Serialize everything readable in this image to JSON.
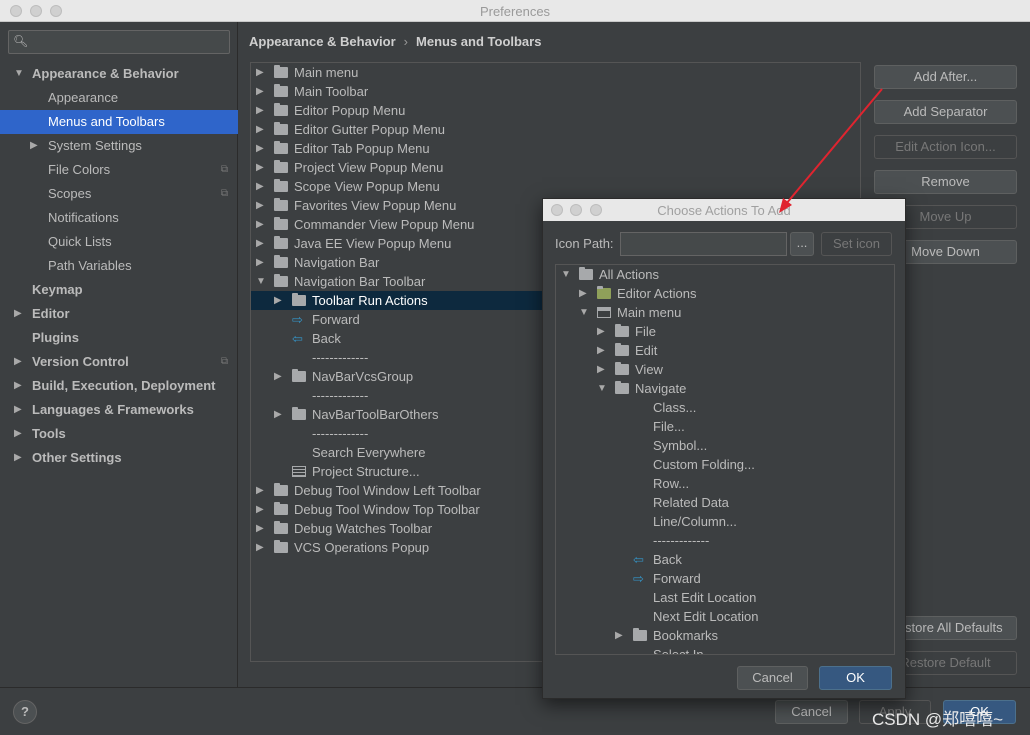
{
  "window": {
    "title": "Preferences"
  },
  "sidebar": {
    "search_placeholder": "",
    "search_icon": "search-icon",
    "items": [
      {
        "label": "Appearance & Behavior",
        "bold": true,
        "expanded": true,
        "level": 0
      },
      {
        "label": "Appearance",
        "level": 1
      },
      {
        "label": "Menus and Toolbars",
        "level": 1,
        "selected": true
      },
      {
        "label": "System Settings",
        "level": 1,
        "collapsed": true
      },
      {
        "label": "File Colors",
        "level": 1,
        "copy": true
      },
      {
        "label": "Scopes",
        "level": 1,
        "copy": true
      },
      {
        "label": "Notifications",
        "level": 1
      },
      {
        "label": "Quick Lists",
        "level": 1
      },
      {
        "label": "Path Variables",
        "level": 1
      },
      {
        "label": "Keymap",
        "bold": true,
        "level": 0
      },
      {
        "label": "Editor",
        "bold": true,
        "level": 0,
        "collapsed": true
      },
      {
        "label": "Plugins",
        "bold": true,
        "level": 0
      },
      {
        "label": "Version Control",
        "bold": true,
        "level": 0,
        "collapsed": true,
        "copy": true
      },
      {
        "label": "Build, Execution, Deployment",
        "bold": true,
        "level": 0,
        "collapsed": true
      },
      {
        "label": "Languages & Frameworks",
        "bold": true,
        "level": 0,
        "collapsed": true
      },
      {
        "label": "Tools",
        "bold": true,
        "level": 0,
        "collapsed": true
      },
      {
        "label": "Other Settings",
        "bold": true,
        "level": 0,
        "collapsed": true
      }
    ]
  },
  "breadcrumb": {
    "part1": "Appearance & Behavior",
    "separator": "›",
    "part2": "Menus and Toolbars"
  },
  "main_tree": {
    "rows": [
      {
        "label": "Main menu",
        "level": 0,
        "arrow": "right",
        "icon": "folder"
      },
      {
        "label": "Main Toolbar",
        "level": 0,
        "arrow": "right",
        "icon": "folder"
      },
      {
        "label": "Editor Popup Menu",
        "level": 0,
        "arrow": "right",
        "icon": "folder"
      },
      {
        "label": "Editor Gutter Popup Menu",
        "level": 0,
        "arrow": "right",
        "icon": "folder"
      },
      {
        "label": "Editor Tab Popup Menu",
        "level": 0,
        "arrow": "right",
        "icon": "folder"
      },
      {
        "label": "Project View Popup Menu",
        "level": 0,
        "arrow": "right",
        "icon": "folder"
      },
      {
        "label": "Scope View Popup Menu",
        "level": 0,
        "arrow": "right",
        "icon": "folder"
      },
      {
        "label": "Favorites View Popup Menu",
        "level": 0,
        "arrow": "right",
        "icon": "folder"
      },
      {
        "label": "Commander View Popup Menu",
        "level": 0,
        "arrow": "right",
        "icon": "folder"
      },
      {
        "label": "Java EE View Popup Menu",
        "level": 0,
        "arrow": "right",
        "icon": "folder"
      },
      {
        "label": "Navigation Bar",
        "level": 0,
        "arrow": "right",
        "icon": "folder"
      },
      {
        "label": "Navigation Bar Toolbar",
        "level": 0,
        "arrow": "down",
        "icon": "folder"
      },
      {
        "label": "Toolbar Run Actions",
        "level": 1,
        "arrow": "right",
        "icon": "folder",
        "selected": true
      },
      {
        "label": "Forward",
        "level": 1,
        "icon": "forward"
      },
      {
        "label": "Back",
        "level": 1,
        "icon": "back"
      },
      {
        "label": "-------------",
        "level": 1
      },
      {
        "label": "NavBarVcsGroup",
        "level": 1,
        "arrow": "right",
        "icon": "folder"
      },
      {
        "label": "-------------",
        "level": 1
      },
      {
        "label": "NavBarToolBarOthers",
        "level": 1,
        "arrow": "right",
        "icon": "folder"
      },
      {
        "label": "-------------",
        "level": 1
      },
      {
        "label": "Search Everywhere",
        "level": 1
      },
      {
        "label": "Project Structure...",
        "level": 1,
        "icon": "structure"
      },
      {
        "label": "Debug Tool Window Left Toolbar",
        "level": 0,
        "arrow": "right",
        "icon": "folder"
      },
      {
        "label": "Debug Tool Window Top Toolbar",
        "level": 0,
        "arrow": "right",
        "icon": "folder"
      },
      {
        "label": "Debug Watches Toolbar",
        "level": 0,
        "arrow": "right",
        "icon": "folder"
      },
      {
        "label": "VCS Operations Popup",
        "level": 0,
        "arrow": "right",
        "icon": "folder"
      }
    ]
  },
  "actions": {
    "add_after": "Add After...",
    "add_separator": "Add Separator",
    "edit_action_icon": "Edit Action Icon...",
    "remove": "Remove",
    "move_up": "Move Up",
    "move_down": "Move Down",
    "restore_all_defaults": "Restore All Defaults",
    "restore_default": "Restore Default"
  },
  "footer": {
    "help": "?",
    "cancel": "Cancel",
    "apply": "Apply",
    "ok": "OK"
  },
  "dialog": {
    "title": "Choose Actions To Add",
    "icon_path_label": "Icon Path:",
    "icon_path_value": "",
    "browse": "...",
    "set_icon": "Set icon",
    "rows": [
      {
        "label": "All Actions",
        "level": 0,
        "arrow": "down",
        "icon": "folder"
      },
      {
        "label": "Editor Actions",
        "level": 1,
        "arrow": "right",
        "icon": "editor"
      },
      {
        "label": "Main menu",
        "level": 1,
        "arrow": "down",
        "icon": "menu"
      },
      {
        "label": "File",
        "level": 2,
        "arrow": "right",
        "icon": "folder"
      },
      {
        "label": "Edit",
        "level": 2,
        "arrow": "right",
        "icon": "folder"
      },
      {
        "label": "View",
        "level": 2,
        "arrow": "right",
        "icon": "folder"
      },
      {
        "label": "Navigate",
        "level": 2,
        "arrow": "down",
        "icon": "folder"
      },
      {
        "label": "Class...",
        "level": 3
      },
      {
        "label": "File...",
        "level": 3
      },
      {
        "label": "Symbol...",
        "level": 3
      },
      {
        "label": "Custom Folding...",
        "level": 3
      },
      {
        "label": "Row...",
        "level": 3
      },
      {
        "label": "Related Data",
        "level": 3
      },
      {
        "label": "Line/Column...",
        "level": 3
      },
      {
        "label": "-------------",
        "level": 3
      },
      {
        "label": "Back",
        "level": 3,
        "icon": "back"
      },
      {
        "label": "Forward",
        "level": 3,
        "icon": "forward"
      },
      {
        "label": "Last Edit Location",
        "level": 3
      },
      {
        "label": "Next Edit Location",
        "level": 3
      },
      {
        "label": "Bookmarks",
        "level": 3,
        "arrow": "right",
        "icon": "folder"
      },
      {
        "label": "Select In",
        "level": 3
      }
    ],
    "cancel": "Cancel",
    "ok": "OK"
  },
  "watermark": "CSDN @郑嘻嘻~",
  "colors": {
    "accent_selected": "#2f65ca",
    "tree_selected": "#0d293e",
    "primary_button": "#365880",
    "annotation_arrow": "#e0242f"
  }
}
